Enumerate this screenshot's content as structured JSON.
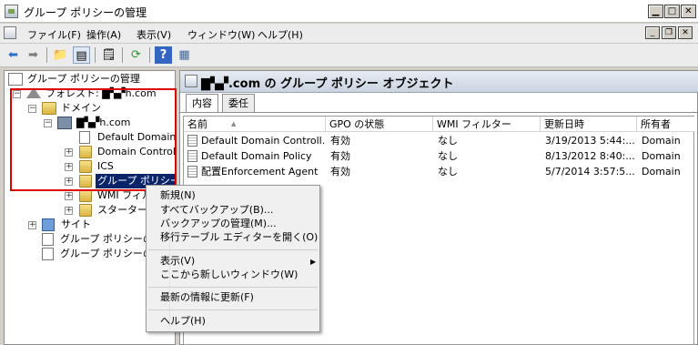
{
  "window": {
    "title": "グループ ポリシーの管理"
  },
  "menubar": {
    "items": [
      "ファイル(F)",
      "操作(A)",
      "表示(V)",
      "ウィンドウ(W)",
      "ヘルプ(H)"
    ]
  },
  "toolbar": {
    "icons": [
      "back-arrow-icon",
      "forward-arrow-icon",
      "up-folder-icon",
      "show-hide-tree-icon",
      "properties-icon",
      "refresh-icon",
      "help-icon",
      "show-action-pane-icon"
    ]
  },
  "tree": {
    "root": "グループ ポリシーの管理",
    "forest": "フォレスト: ▇▚▞h.com",
    "domains": "ドメイン",
    "domain": "▇▚▞h.com",
    "default_domain": "Default Domain",
    "domain_controllers": "Domain Controlle",
    "ics": "ICS",
    "gpo": "グループ ポリシー",
    "wmi": "WMI フィル",
    "starter": "スターター G",
    "sites": "サイト",
    "modeling": "グループ ポリシーの",
    "results": "グループ ポリシーの"
  },
  "right_pane": {
    "title": "▇▚▞.com の グループ ポリシー オブジェクト",
    "tabs": [
      "内容",
      "委任"
    ],
    "columns": [
      "名前",
      "GPO の状態",
      "WMI フィルター",
      "更新日時",
      "所有者"
    ],
    "rows": [
      [
        "Default Domain Controll...",
        "有効",
        "なし",
        "3/19/2013 5:44:...",
        "Domain"
      ],
      [
        "Default Domain Policy",
        "有効",
        "なし",
        "8/13/2012 8:40:...",
        "Domain"
      ],
      [
        "配置Enforcement Agent",
        "有効",
        "なし",
        "5/7/2014 3:57:5...",
        "Domain"
      ]
    ]
  },
  "context_menu": {
    "new": "新規(N)",
    "backup_all": "すべてバックアップ(B)...",
    "manage_backups": "バックアップの管理(M)...",
    "migration_editor": "移行テーブル エディターを開く(O)",
    "view": "表示(V)",
    "new_window": "ここから新しいウィンドウ(W)",
    "refresh": "最新の情報に更新(F)",
    "help": "ヘルプ(H)"
  },
  "colors": {
    "highlight": "#0a246a",
    "annotation_box": "#e00000"
  }
}
